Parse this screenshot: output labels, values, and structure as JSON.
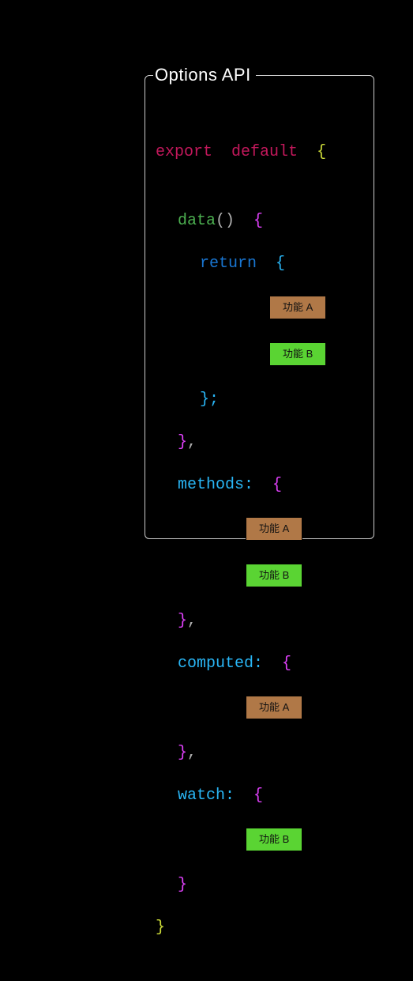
{
  "title": "Options API",
  "tokens": {
    "export": "export",
    "default": "default",
    "data": "data",
    "paren": "()",
    "return": "return",
    "methods": "methods:",
    "computed": "computed:",
    "watch": "watch:",
    "lbrace": "{",
    "rbrace": "}",
    "rbrace_semi": "};",
    "rbrace_comma": "},"
  },
  "tags": {
    "featureA": "功能 A",
    "featureB": "功能 B"
  }
}
